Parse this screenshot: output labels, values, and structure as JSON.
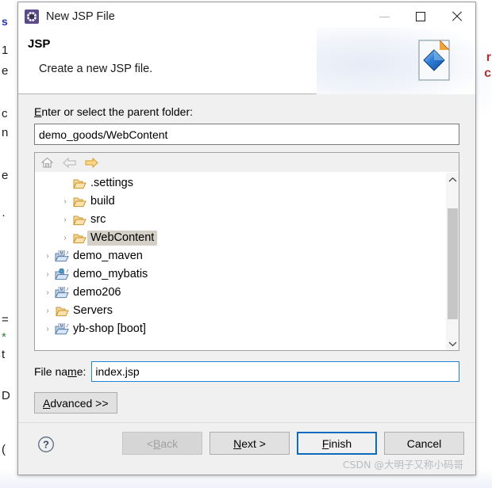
{
  "window": {
    "title": "New JSP File",
    "icon": "gear-icon",
    "controls": {
      "minimize": "minimize-icon",
      "maximize": "maximize-icon",
      "close": "close-icon"
    }
  },
  "banner": {
    "title": "JSP",
    "subtitle": "Create a new JSP file.",
    "image": "jsp-file-wizard-icon"
  },
  "parent_folder": {
    "label_before": "E",
    "label_after": "nter or select the parent folder:",
    "value": "demo_goods/WebContent",
    "placeholder": ""
  },
  "tree_toolbar": {
    "home": "home-icon",
    "back": "back-arrow-icon",
    "forward": "forward-arrow-icon"
  },
  "tree": {
    "items": [
      {
        "label": ".settings",
        "indent": 2,
        "twisty": "",
        "icon": "folder-open-icon",
        "selected": false
      },
      {
        "label": "build",
        "indent": 2,
        "twisty": "›",
        "icon": "folder-open-icon",
        "selected": false
      },
      {
        "label": "src",
        "indent": 2,
        "twisty": "›",
        "icon": "folder-open-icon",
        "selected": false
      },
      {
        "label": "WebContent",
        "indent": 2,
        "twisty": "›",
        "icon": "folder-open-icon",
        "selected": true
      },
      {
        "label": "demo_maven",
        "indent": 1,
        "twisty": "›",
        "icon": "maven-project-icon",
        "selected": false
      },
      {
        "label": "demo_mybatis",
        "indent": 1,
        "twisty": "›",
        "icon": "web-project-icon",
        "selected": false
      },
      {
        "label": "demo206",
        "indent": 1,
        "twisty": "›",
        "icon": "maven-project-icon",
        "selected": false
      },
      {
        "label": "Servers",
        "indent": 1,
        "twisty": "›",
        "icon": "folder-open-icon",
        "selected": false
      },
      {
        "label": "yb-shop [boot]",
        "indent": 1,
        "twisty": "›",
        "icon": "maven-project-icon",
        "selected": false
      }
    ],
    "scrollbar": {
      "up": "chevron-up-icon",
      "down": "chevron-down-icon"
    }
  },
  "file_name": {
    "label_a": "File na",
    "label_key": "m",
    "label_b": "e:",
    "value": "index.jsp"
  },
  "advanced": {
    "key": "A",
    "rest": "dvanced >>"
  },
  "footer": {
    "help": "help-icon",
    "buttons": [
      {
        "name": "back-button",
        "pre": "< ",
        "key": "B",
        "post": "ack",
        "state": "disabled"
      },
      {
        "name": "next-button",
        "pre": "",
        "key": "N",
        "post": "ext >",
        "state": "normal"
      },
      {
        "name": "finish-button",
        "pre": "",
        "key": "F",
        "post": "inish",
        "state": "default"
      },
      {
        "name": "cancel-button",
        "pre": "",
        "key": "",
        "post": "Cancel",
        "state": "normal"
      }
    ],
    "watermark": "CSDN @大明子又称小码哥"
  },
  "backdrop": {
    "left_glyphs": [
      "s",
      "1",
      "e",
      "c",
      "n",
      "e",
      "·",
      "=",
      "*",
      "t",
      "D",
      "("
    ],
    "right_glyphs": [
      "r",
      "c"
    ]
  },
  "colors": {
    "dialog_bg": "#f0f0f0",
    "accent": "#0f6cbd",
    "focus_border": "#1e84d8",
    "selection": "#d4d0c8",
    "folder": "#e8a33d",
    "title_icon": "#5c4a8a"
  }
}
